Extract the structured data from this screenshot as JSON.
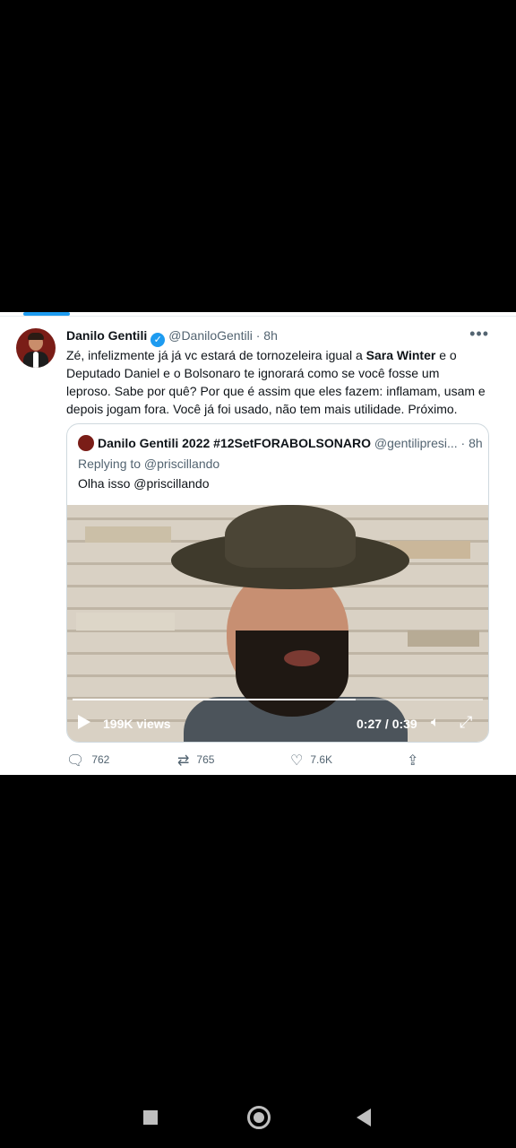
{
  "tweet": {
    "author_name": "Danilo Gentili",
    "handle": "@DaniloGentili",
    "time": "8h",
    "more_icon": "more-icon",
    "text_part1": "Zé, infelizmente já já vc estará de tornozeleira igual a ",
    "text_bold": "Sara Winter",
    "text_part2": " e o Deputado Daniel e o Bolsonaro te ignorará como se você fosse um leproso. Sabe por quê? Por que é assim que eles fazem: inflamam, usam e depois jogam fora. Você já foi usado, não tem mais utilidade. Próximo."
  },
  "quote": {
    "author_name": "Danilo Gentili 2022 #12SetFORABOLSONARO",
    "handle": "@gentilipresi...",
    "time": "8h",
    "replying": "Replying to @priscillando",
    "text": "Olha isso @priscillando",
    "video": {
      "views": "199K views",
      "time": "0:27 / 0:39",
      "progress": 0.69
    }
  },
  "actions": {
    "replies": "762",
    "retweets": "765",
    "likes": "7.6K"
  },
  "colors": {
    "accent": "#1d9bf0",
    "muted": "#536471"
  }
}
